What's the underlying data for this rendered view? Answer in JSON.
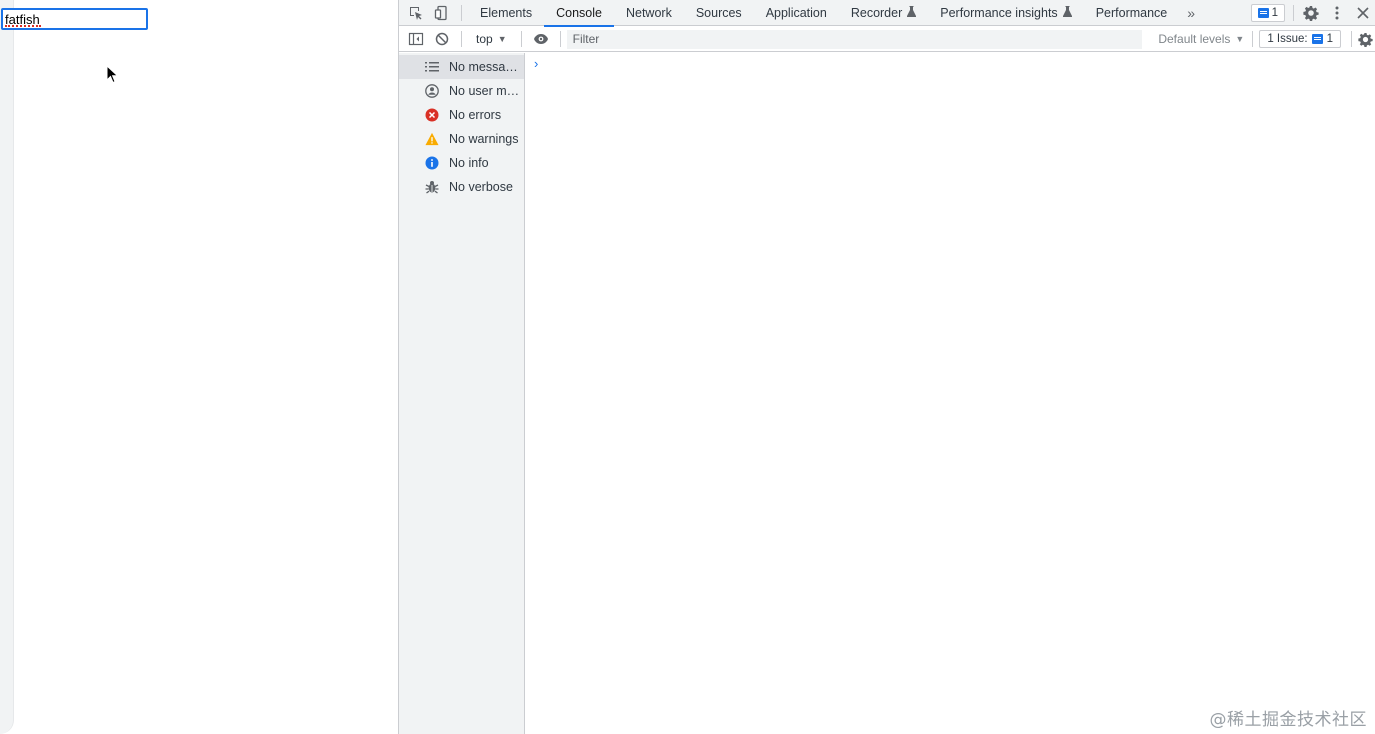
{
  "page": {
    "input_value": "fatfish"
  },
  "devtools": {
    "tabs": [
      {
        "label": "Elements",
        "active": false,
        "experimental": false
      },
      {
        "label": "Console",
        "active": true,
        "experimental": false
      },
      {
        "label": "Network",
        "active": false,
        "experimental": false
      },
      {
        "label": "Sources",
        "active": false,
        "experimental": false
      },
      {
        "label": "Application",
        "active": false,
        "experimental": false
      },
      {
        "label": "Recorder",
        "active": false,
        "experimental": true
      },
      {
        "label": "Performance insights",
        "active": false,
        "experimental": true
      },
      {
        "label": "Performance",
        "active": false,
        "experimental": false
      }
    ],
    "message_badge_count": "1",
    "toolbar": {
      "context": "top",
      "filter_placeholder": "Filter",
      "levels": "Default levels",
      "issues_label": "1 Issue:",
      "issues_count": "1"
    },
    "sidebar": [
      {
        "label": "No messages",
        "icon": "list-icon",
        "selected": true
      },
      {
        "label": "No user messages",
        "icon": "user-icon",
        "selected": false
      },
      {
        "label": "No errors",
        "icon": "error-icon",
        "selected": false
      },
      {
        "label": "No warnings",
        "icon": "warning-icon",
        "selected": false
      },
      {
        "label": "No info",
        "icon": "info-icon",
        "selected": false
      },
      {
        "label": "No verbose",
        "icon": "bug-icon",
        "selected": false
      }
    ],
    "prompt_symbol": "›"
  },
  "watermark": "@稀土掘金技术社区",
  "colors": {
    "accent": "#1a73e8",
    "error": "#d93025",
    "warning": "#f9ab00",
    "info": "#1a73e8"
  }
}
